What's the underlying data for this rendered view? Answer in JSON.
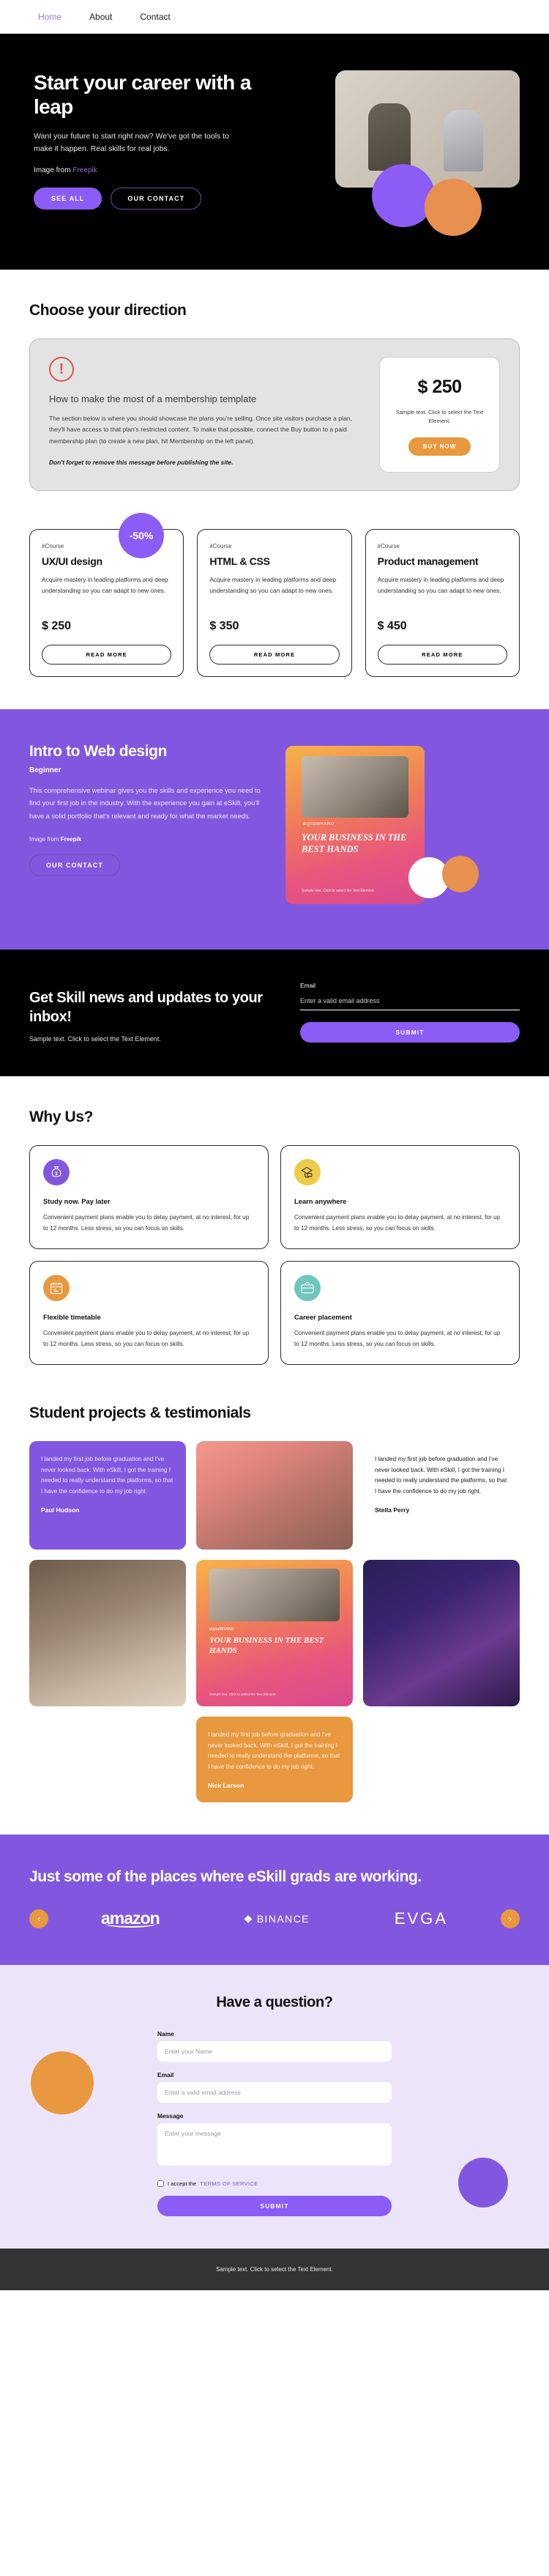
{
  "nav": {
    "items": [
      {
        "label": "Home",
        "active": true
      },
      {
        "label": "About",
        "active": false
      },
      {
        "label": "Contact",
        "active": false
      }
    ]
  },
  "hero": {
    "title": "Start your career with a leap",
    "lead": "Want your future to start right now? We've got the tools to make it happen. Real skills for real jobs.",
    "credit_prefix": "Image from",
    "credit_link": "Freepik",
    "primary_button": "SEE ALL",
    "secondary_button": "OUR CONTACT"
  },
  "direction": {
    "title": "Choose your direction",
    "notice": {
      "icon": "!",
      "heading": "How to make the most of a membership template",
      "body": "The section below is where you should showcase the plans you're selling. Once site visitors purchase a plan, they'll have access to that plan's restricted content. To make that possible, connect the Buy button to a paid membership plan (to create a new plan, hit Membership on the left panel).",
      "warning": "Don't forget to remove this message before publishing the site."
    },
    "price_card": {
      "amount": "$ 250",
      "sub": "Sample text. Click to select the Text Element.",
      "button": "BUY NOW"
    }
  },
  "courses": {
    "discount_badge": "-50%",
    "cards": [
      {
        "tag": "#Course",
        "title": "UX/UI design",
        "desc": "Acquire mastery in leading platforms and deep understanding so you can adapt to new ones.",
        "price": "$ 250",
        "button": "READ MORE"
      },
      {
        "tag": "#Course",
        "title": "HTML & CSS",
        "desc": "Acquire mastery in leading platforms and deep understanding so you can adapt to new ones.",
        "price": "$ 350",
        "button": "READ MORE"
      },
      {
        "tag": "#Course",
        "title": "Product management",
        "desc": "Acquire mastery in leading platforms and deep understanding so you can adapt to new ones.",
        "price": "$ 450",
        "button": "READ MORE"
      }
    ]
  },
  "webinar": {
    "title": "Intro to Web design",
    "level": "Beginner",
    "body": "This comprehensive webinar gives you the skills and experience you need to find your first job in the industry. With the experience you gain at eSkill, you'll have a solid portfolio that's relevant and ready for what the market needs.",
    "credit_prefix": "Image from",
    "credit_link": "Freepik",
    "button": "OUR CONTACT",
    "poster": {
      "brand": "digitalBRAND",
      "title": "YOUR BUSINESS IN THE BEST HANDS",
      "foot": "Sample text. Click to select the Text Element."
    }
  },
  "newsletter": {
    "title": "Get Skill news and updates to your inbox!",
    "sub": "Sample text. Click to select the Text Element.",
    "email_label": "Email",
    "email_placeholder": "Enter a valid email address",
    "email_value": "",
    "submit": "SUBMIT"
  },
  "why": {
    "title": "Why Us?",
    "cards": [
      {
        "icon": "money-bag-icon",
        "color": "#8257e0",
        "title": "Study now. Pay later",
        "desc": "Convenient payment plans enable you to delay payment, at no interest, for up to 12 months. Less stress, so you can focus on skills."
      },
      {
        "icon": "hand-card-icon",
        "color": "#edcc4a",
        "title": "Learn anywhere",
        "desc": "Convenient payment plans enable you to delay payment, at no interest, for up to 12 months. Less stress, so you can focus on skills."
      },
      {
        "icon": "calendar-icon",
        "color": "#e8983f",
        "title": "Flexible timetable",
        "desc": "Convenient payment plans enable you to delay payment, at no interest, for up to 12 months. Less stress, so you can focus on skills."
      },
      {
        "icon": "briefcase-icon",
        "color": "#6fc6bd",
        "title": "Career placement",
        "desc": "Convenient payment plans enable you to delay payment, at no interest, for up to 12 months. Less stress, so you can focus on skills."
      }
    ]
  },
  "testimonials": {
    "title": "Student projects & testimonials",
    "quote": "I landed my first job before graduation and I've never looked back. With eSkill, I got the training I needed to really understand the platforms, so that I have the confidence to do my job right.",
    "items": [
      {
        "type": "quote",
        "style": "purple",
        "author": "Paul Hudson"
      },
      {
        "type": "image",
        "style": "hands"
      },
      {
        "type": "quote",
        "style": "white",
        "author": "Stella Perry"
      },
      {
        "type": "image",
        "style": "classroom"
      },
      {
        "type": "poster",
        "style": "poster"
      },
      {
        "type": "image",
        "style": "robot"
      },
      {
        "type": "quote",
        "style": "orange",
        "author": "Nick Larson"
      }
    ],
    "poster": {
      "brand": "digitalBRAND",
      "title": "YOUR BUSINESS IN THE BEST HANDS",
      "foot": "Sample text. Click to select the Text Element."
    }
  },
  "partners": {
    "title": "Just some of the places where eSkill grads are working.",
    "prev_icon": "chevron-left-icon",
    "next_icon": "chevron-right-icon",
    "logos": [
      "amazon",
      "BINANCE",
      "EVGA"
    ]
  },
  "contact": {
    "title": "Have a question?",
    "name_label": "Name",
    "name_placeholder": "Enter your Name",
    "name_value": "",
    "email_label": "Email",
    "email_placeholder": "Enter a valid email address",
    "email_value": "",
    "message_label": "Message",
    "message_placeholder": "Enter your message",
    "message_value": "",
    "tos_prefix": "I accept the",
    "tos_link": "TERMS OF SERVICE",
    "submit": "SUBMIT"
  },
  "footer": {
    "text": "Sample text. Click to select the Text Element."
  },
  "colors": {
    "purple": "#8257e0",
    "purple_light": "#8b5cf6",
    "orange": "#e8983f",
    "black": "#000000",
    "contact_bg": "#ece5fa",
    "footer_bg": "#333333"
  }
}
